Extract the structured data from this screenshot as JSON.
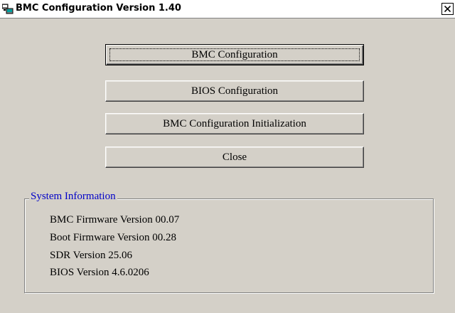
{
  "window": {
    "title": "BMC Configuration Version 1.40",
    "title_icon": "app-window-icon",
    "close_icon": "close-icon"
  },
  "buttons": [
    {
      "label": "BMC Configuration",
      "is_default": true
    },
    {
      "label": "BIOS Configuration",
      "is_default": false
    },
    {
      "label": "BMC Configuration Initialization",
      "is_default": false
    },
    {
      "label": "Close",
      "is_default": false
    }
  ],
  "system_info": {
    "group_label": "System Information",
    "lines": [
      "BMC Firmware Version 00.07",
      "Boot Firmware Version 00.28",
      "SDR Version 25.06",
      "BIOS Version 4.6.0206"
    ]
  },
  "colors": {
    "face": "#d4d0c8",
    "group_label": "#0000c8"
  }
}
